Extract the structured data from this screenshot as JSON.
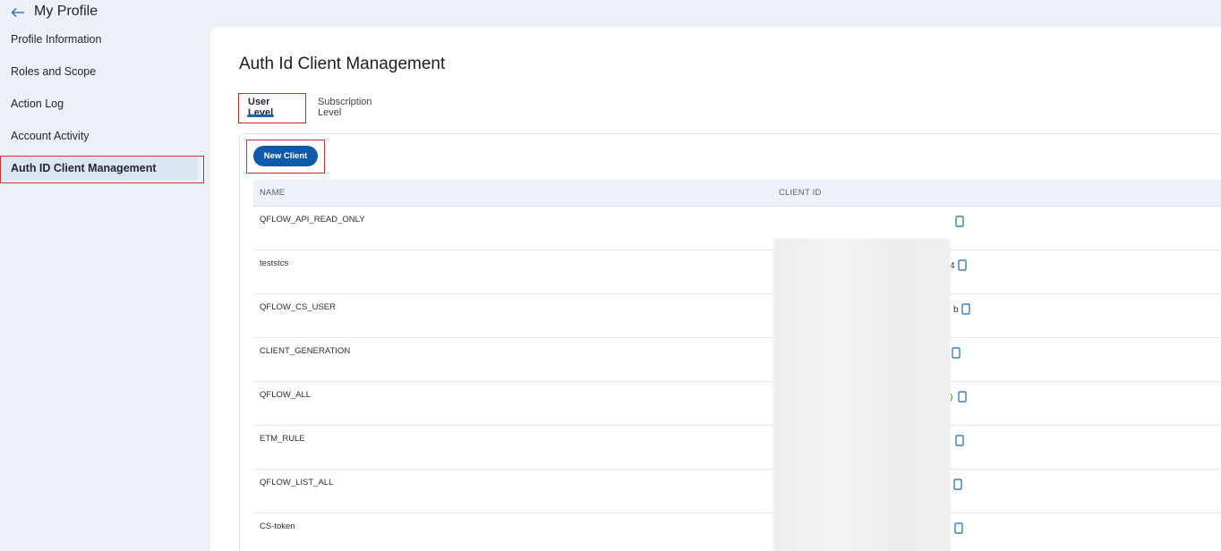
{
  "header": {
    "title": "My Profile"
  },
  "sidebar": {
    "items": [
      {
        "label": "Profile Information"
      },
      {
        "label": "Roles and Scope"
      },
      {
        "label": "Action Log"
      },
      {
        "label": "Account Activity"
      },
      {
        "label": "Auth ID Client Management",
        "active": true
      }
    ]
  },
  "main": {
    "title": "Auth Id Client Management",
    "tabs": [
      {
        "label": "User Level",
        "active": true
      },
      {
        "label": "Subscription Level"
      }
    ],
    "new_client_label": "New Client",
    "table": {
      "columns": [
        "NAME",
        "CLIENT ID"
      ],
      "rows": [
        {
          "name": "QFLOW_API_READ_ONLY",
          "client_id_visible_tail": ""
        },
        {
          "name": "teststcs",
          "client_id_visible_tail": "4"
        },
        {
          "name": "QFLOW_CS_USER",
          "client_id_visible_tail": "b"
        },
        {
          "name": "CLIENT_GENERATION",
          "client_id_visible_tail": ""
        },
        {
          "name": "QFLOW_ALL",
          "client_id_visible_tail": ")"
        },
        {
          "name": "ETM_RULE",
          "client_id_visible_tail": ""
        },
        {
          "name": "QFLOW_LIST_ALL",
          "client_id_visible_tail": ""
        },
        {
          "name": "CS-token",
          "client_id_visible_tail": ""
        }
      ]
    }
  },
  "colors": {
    "accent": "#1667b8",
    "button": "#0f5bab",
    "highlight_outline": "#d32f2f",
    "page_bg": "#ecf1f8"
  },
  "icons": [
    "back-arrow-icon",
    "copy-icon"
  ]
}
